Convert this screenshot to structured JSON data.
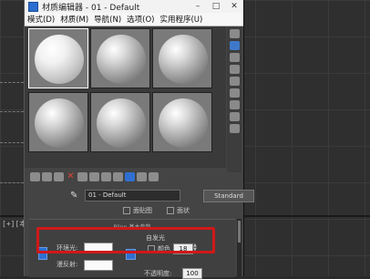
{
  "window": {
    "title": "材质编辑器 - 01 - Default",
    "controls": {
      "minimize": "–",
      "maximize": "□",
      "close": "✕"
    }
  },
  "menu": [
    "模式(D)",
    "材质(M)",
    "导航(N)",
    "选项(O)",
    "实用程序(U)"
  ],
  "viewport": {
    "label": "[+][本"
  },
  "material": {
    "name": "01 - Default",
    "type": "Standard"
  },
  "toolbar_icons": [
    "get-material-icon",
    "put-to-scene-icon",
    "assign-icon",
    "delete-icon",
    "copy-icon",
    "unique-icon",
    "put-library-icon",
    "material-id-icon",
    "show-map-icon",
    "show-shaded-icon",
    "go-to-parent-icon"
  ],
  "side_icons": [
    "sample-type-icon",
    "backlight-icon",
    "background-icon",
    "uv-tiling-icon",
    "video-color-icon",
    "make-preview-icon",
    "options-icon",
    "select-by-material-icon",
    "material-navigator-icon"
  ],
  "checkboxes": {
    "faceted": "面贴图",
    "wire": "面状"
  },
  "rollout": {
    "title": "Blinn 基本参数",
    "ambient_label": "环境光:",
    "diffuse_label": "漫反射:",
    "self_illum_title": "自发光",
    "color_label": "颜色",
    "self_illum_value": "18",
    "opacity_label": "不透明度:",
    "opacity_value": "100"
  },
  "colors": {
    "highlight": "#d01818",
    "accent": "#2f6fd1"
  }
}
